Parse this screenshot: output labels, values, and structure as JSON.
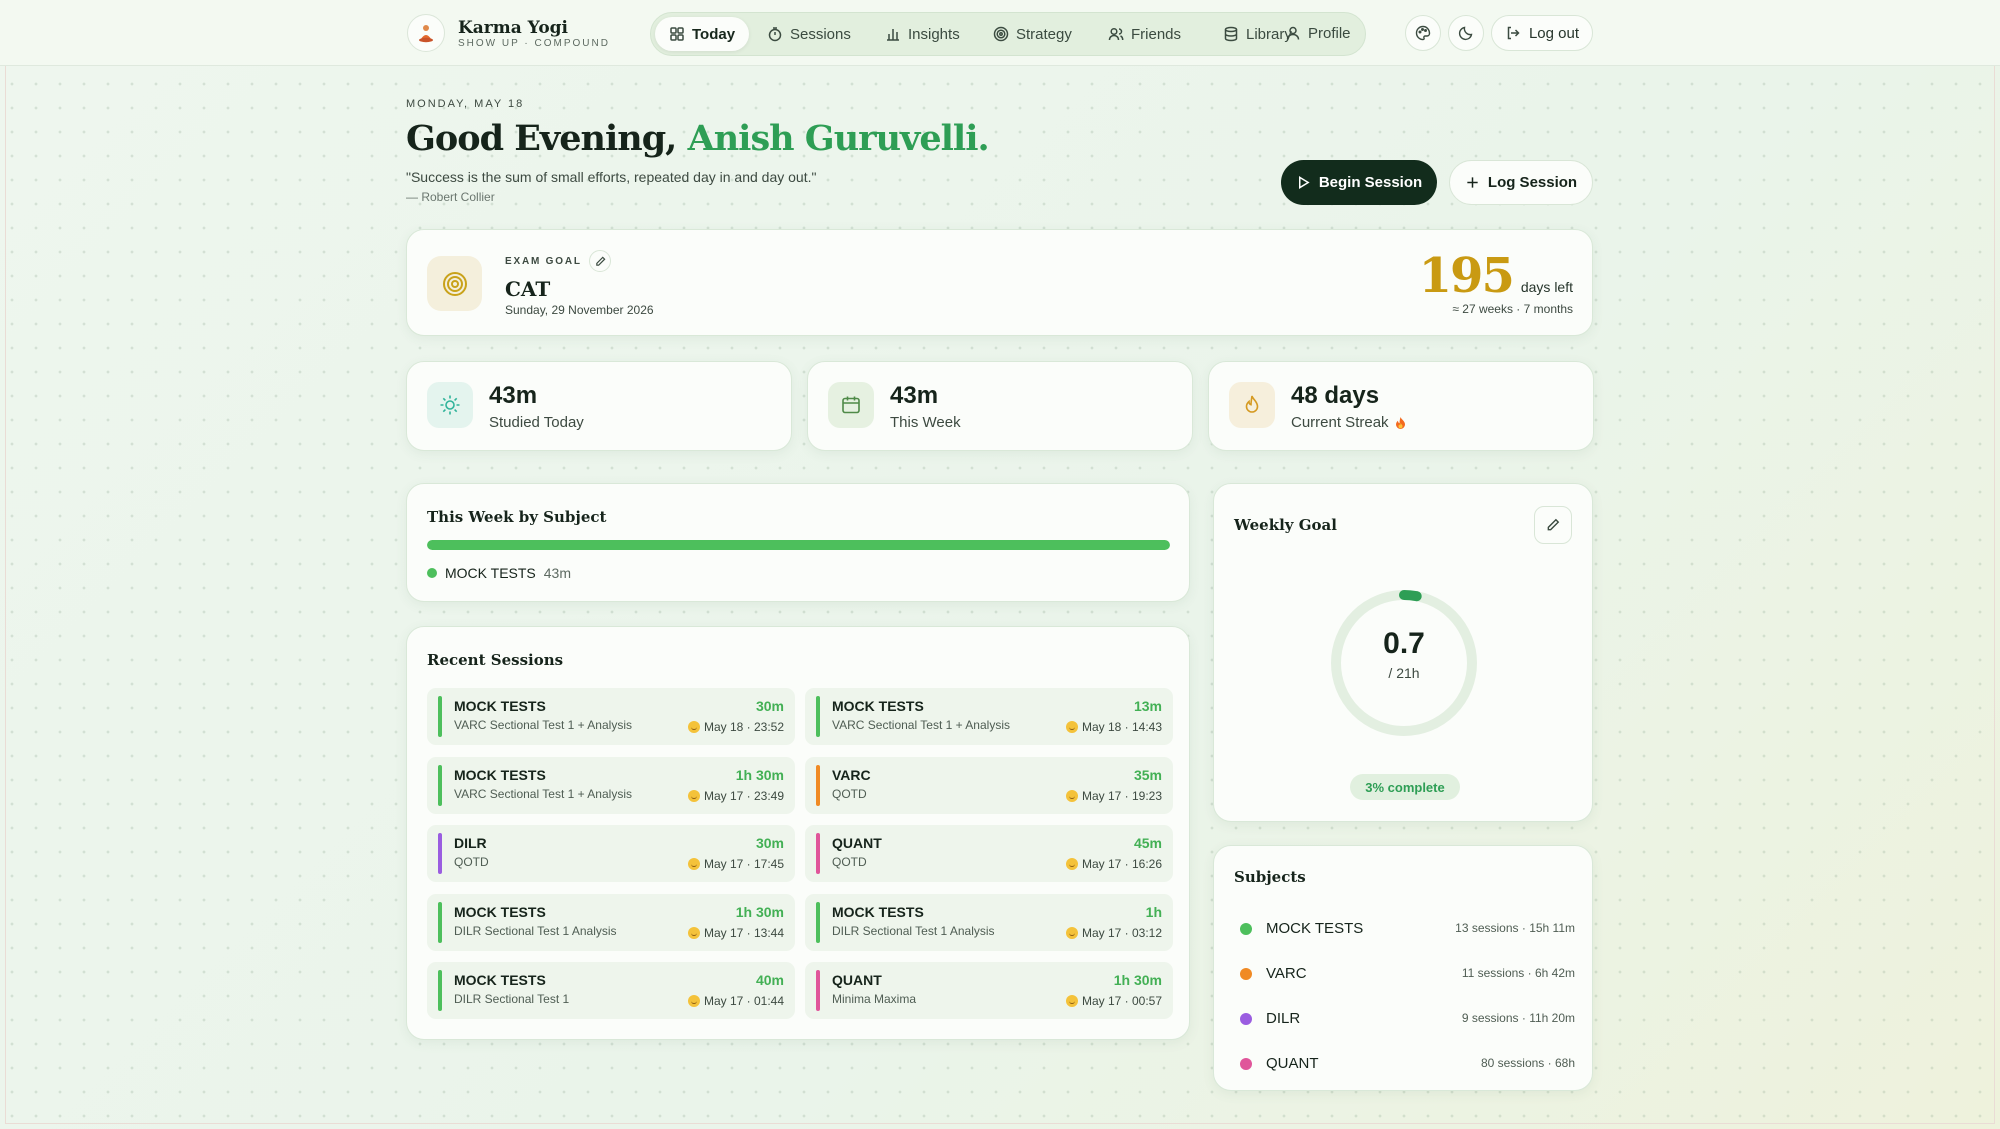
{
  "app": {
    "name": "Karma Yogi",
    "tagline": "SHOW UP · COMPOUND"
  },
  "nav": {
    "items": [
      {
        "label": "Today",
        "icon": "grid-icon",
        "active": true
      },
      {
        "label": "Sessions",
        "icon": "timer-icon"
      },
      {
        "label": "Insights",
        "icon": "bar-chart-icon"
      },
      {
        "label": "Strategy",
        "icon": "target-icon"
      },
      {
        "label": "Friends",
        "icon": "users-icon"
      },
      {
        "label": "Library",
        "icon": "database-icon"
      },
      {
        "label": "Profile",
        "icon": "user-icon"
      }
    ]
  },
  "header_actions": {
    "theme_icon": "palette-icon",
    "mode_icon": "moon-icon",
    "logout_label": "Log out"
  },
  "greeting": {
    "date": "MONDAY, MAY 18",
    "prefix": "Good Evening,",
    "name": "Anish Guruvelli.",
    "quote": "\"Success is the sum of small efforts, repeated day in and day out.\"",
    "author": "— Robert Collier"
  },
  "actions": {
    "begin": "Begin Session",
    "log": "Log Session"
  },
  "exam": {
    "label": "EXAM GOAL",
    "name": "CAT",
    "date": "Sunday, 29 November 2026",
    "days": "195",
    "days_label": "days left",
    "approx": "≈ 27 weeks · 7 months"
  },
  "stats": [
    {
      "value": "43m",
      "label": "Studied Today",
      "icon": "sun-icon"
    },
    {
      "value": "43m",
      "label": "This Week",
      "icon": "calendar-icon"
    },
    {
      "value": "48 days",
      "label": "Current Streak",
      "icon": "flame-icon"
    }
  ],
  "week_subject": {
    "title": "This Week by Subject",
    "items": [
      {
        "name": "MOCK TESTS",
        "time": "43m",
        "share": 1.0,
        "color": "#4dbf5c"
      }
    ]
  },
  "recent": {
    "title": "Recent Sessions",
    "sessions": [
      {
        "subject": "MOCK TESTS",
        "desc": "VARC Sectional Test 1 + Analysis",
        "dur": "30m",
        "meta": "May 18 · 23:52",
        "color": "#4dbf5c"
      },
      {
        "subject": "MOCK TESTS",
        "desc": "VARC Sectional Test 1 + Analysis",
        "dur": "13m",
        "meta": "May 18 · 14:43",
        "color": "#4dbf5c"
      },
      {
        "subject": "MOCK TESTS",
        "desc": "VARC Sectional Test 1 + Analysis",
        "dur": "1h 30m",
        "meta": "May 17 · 23:49",
        "color": "#4dbf5c"
      },
      {
        "subject": "VARC",
        "desc": "QOTD",
        "dur": "35m",
        "meta": "May 17 · 19:23",
        "color": "#f08a24"
      },
      {
        "subject": "DILR",
        "desc": "QOTD",
        "dur": "30m",
        "meta": "May 17 · 17:45",
        "color": "#9a5de0"
      },
      {
        "subject": "QUANT",
        "desc": "QOTD",
        "dur": "45m",
        "meta": "May 17 · 16:26",
        "color": "#e0559a"
      },
      {
        "subject": "MOCK TESTS",
        "desc": "DILR Sectional Test 1 Analysis",
        "dur": "1h 30m",
        "meta": "May 17 · 13:44",
        "color": "#4dbf5c"
      },
      {
        "subject": "MOCK TESTS",
        "desc": "DILR Sectional Test 1 Analysis",
        "dur": "1h",
        "meta": "May 17 · 03:12",
        "color": "#4dbf5c"
      },
      {
        "subject": "MOCK TESTS",
        "desc": "DILR Sectional Test 1",
        "dur": "40m",
        "meta": "May 17 · 01:44",
        "color": "#4dbf5c"
      },
      {
        "subject": "QUANT",
        "desc": "Minima Maxima",
        "dur": "1h 30m",
        "meta": "May 17 · 00:57",
        "color": "#e0559a"
      }
    ]
  },
  "weekly_goal": {
    "title": "Weekly Goal",
    "value": "0.7",
    "target": "/ 21h",
    "progress": 0.03,
    "pct_label": "3% complete"
  },
  "subjects": {
    "title": "Subjects",
    "items": [
      {
        "name": "MOCK TESTS",
        "stats": "13 sessions · 15h 11m",
        "color": "#4dbf5c"
      },
      {
        "name": "VARC",
        "stats": "11 sessions · 6h 42m",
        "color": "#f08a24"
      },
      {
        "name": "DILR",
        "stats": "9 sessions · 11h 20m",
        "color": "#9a5de0"
      },
      {
        "name": "QUANT",
        "stats": "80 sessions · 68h",
        "color": "#e0559a"
      }
    ]
  }
}
